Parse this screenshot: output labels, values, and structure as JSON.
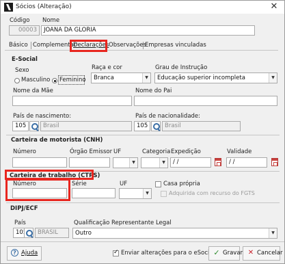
{
  "window": {
    "title": "Sócios (Alteração)",
    "close_glyph": "✕"
  },
  "header": {
    "codigo_label": "Código",
    "codigo_value": "00003",
    "nome_label": "Nome",
    "nome_value": "JOANA DA GLORIA"
  },
  "tabs": [
    {
      "label": "Básico"
    },
    {
      "label": "Complementar"
    },
    {
      "label": "Declarações",
      "active": true
    },
    {
      "label": "Observações"
    },
    {
      "label": "Empresas vinculadas"
    }
  ],
  "esocial": {
    "title": "E-Social",
    "sexo_label": "Sexo",
    "sexo_options": [
      "Masculino",
      "Feminino"
    ],
    "sexo_selected": "Feminino",
    "raca_label": "Raça e cor",
    "raca_value": "Branca",
    "grau_label": "Grau de Instrução",
    "grau_value": "Educação superior incompleta",
    "mae_label": "Nome da Mãe",
    "mae_value": "",
    "pai_label": "Nome do Pai",
    "pai_value": "",
    "nasc_label": "País de nascimento:",
    "nasc_code": "105",
    "nasc_name": "Brasil",
    "nac_label": "País de nacionalidade:",
    "nac_code": "105",
    "nac_name": "Brasil"
  },
  "cnh": {
    "title": "Carteira de motorista (CNH)",
    "numero_label": "Número",
    "orgao_label": "Órgão Emissor",
    "uf_label": "UF",
    "categoria_label": "Categoria",
    "expedicao_label": "Expedição",
    "expedicao_value": " / /",
    "validade_label": "Validade",
    "validade_value": " / /"
  },
  "ctps": {
    "title": "Carteira de trabalho (CTPS)",
    "numero_label": "Número",
    "serie_label": "Série",
    "uf_label": "UF",
    "casa_propria_label": "Casa própria",
    "fgts_label": "Adquirida com recurso do FGTS"
  },
  "dipj": {
    "title": "DIPJ/ECF",
    "pais_label": "País",
    "pais_code": "105",
    "pais_name": "BRASIL",
    "qual_label": "Qualificação Representante Legal",
    "qual_value": "Outro"
  },
  "footer": {
    "ajuda_label": "Ajuda",
    "enviar_label": "Enviar alterações para o eSocial",
    "enviar_checked": true,
    "gravar_label": "Gravar",
    "cancelar_label": "Cancelar"
  },
  "colors": {
    "highlight": "#e8261f",
    "accent": "#3a6ea5",
    "ok_green": "#2e8b2e",
    "cancel_red": "#c8202a"
  }
}
